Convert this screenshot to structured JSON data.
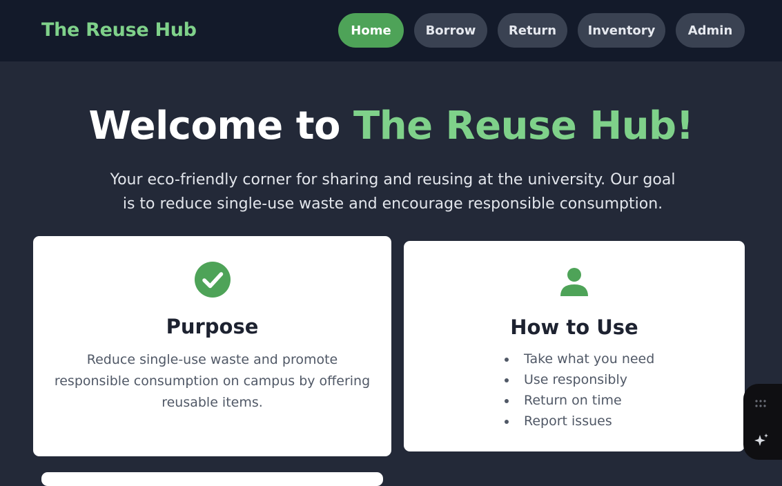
{
  "header": {
    "brand": "The Reuse Hub",
    "nav": [
      {
        "label": "Home",
        "active": true
      },
      {
        "label": "Borrow",
        "active": false
      },
      {
        "label": "Return",
        "active": false
      },
      {
        "label": "Inventory",
        "active": false
      },
      {
        "label": "Admin",
        "active": false
      }
    ]
  },
  "hero": {
    "title_prefix": "Welcome to ",
    "title_accent": "The Reuse Hub!",
    "subtitle": "Your eco-friendly corner for sharing and reusing at the university. Our goal is to reduce single-use waste and encourage responsible consumption."
  },
  "cards": {
    "purpose": {
      "icon": "check-circle-icon",
      "title": "Purpose",
      "text": "Reduce single-use waste and promote responsible consumption on campus by offering reusable items."
    },
    "how_to_use": {
      "icon": "user-icon",
      "title": "How to Use",
      "items": [
        "Take what you need",
        "Use responsibly",
        "Return on time",
        "Report issues"
      ]
    }
  },
  "widget": {
    "icons": [
      "grip-dots-icon",
      "sparkle-icon"
    ]
  },
  "colors": {
    "accent": "#7fd18a",
    "active_nav": "#4ea358",
    "header_bg": "#131a2a",
    "page_bg": "#232938"
  }
}
